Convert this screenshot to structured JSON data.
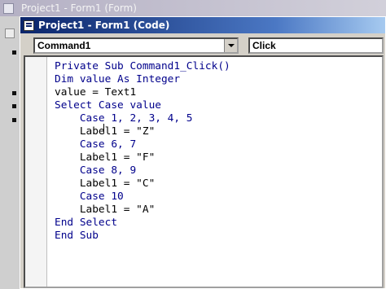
{
  "background_window": {
    "title": "Project1 - Form1 (Form)"
  },
  "code_window": {
    "title": "Project1 - Form1 (Code)",
    "object_combo": {
      "value": "Command1"
    },
    "procedure_combo": {
      "value": "Click"
    }
  },
  "code": {
    "lines": [
      "Private Sub Command1_Click()",
      "Dim value As Integer",
      "value = Text1",
      "Select Case value",
      "    Case 1, 2, 3, 4, 5",
      "    Label1 = \"Z\"",
      "    Case 6, 7",
      "    Label1 = \"F\"",
      "    Case 8, 9",
      "    Label1 = \"C\"",
      "    Case 10",
      "    Label1 = \"A\"",
      "End Select",
      "End Sub"
    ]
  },
  "colors": {
    "keyword": "#00008b",
    "active_title": "#0a246a",
    "inactive_title": "#b4b0c4"
  },
  "icons": [
    "vb-form-icon",
    "vb-code-icon",
    "dropdown-arrow-icon"
  ]
}
